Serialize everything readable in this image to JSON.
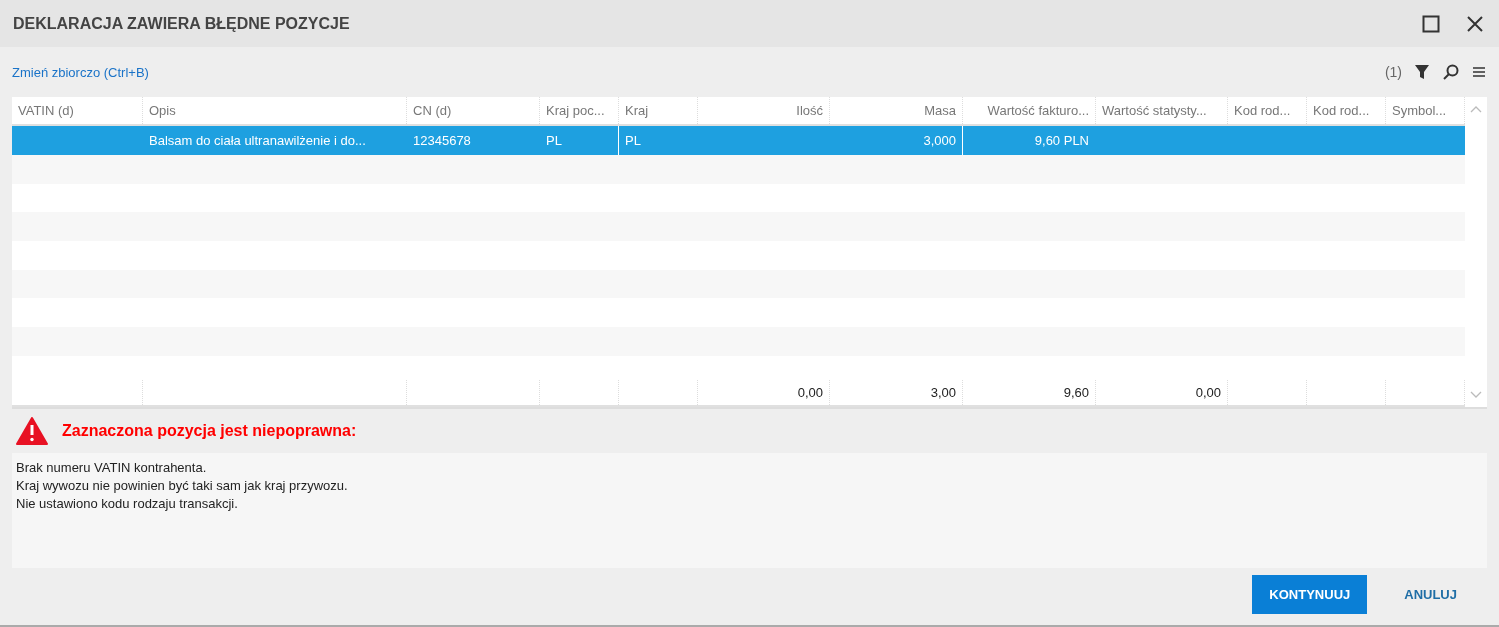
{
  "window": {
    "title": "DEKLARACJA ZAWIERA BŁĘDNE POZYCJE"
  },
  "toolbar": {
    "bulk_change_link": "Zmień zbiorczo (Ctrl+B)",
    "filter_count": "(1)"
  },
  "table": {
    "columns": [
      {
        "label": "VATIN (d)",
        "kind": "text"
      },
      {
        "label": "Opis",
        "kind": "text"
      },
      {
        "label": "CN (d)",
        "kind": "text"
      },
      {
        "label": "Kraj poc...",
        "kind": "text"
      },
      {
        "label": "Kraj",
        "kind": "text"
      },
      {
        "label": "Ilość",
        "kind": "number",
        "total": "0,00"
      },
      {
        "label": "Masa",
        "kind": "number",
        "total": "3,00"
      },
      {
        "label": "Wartość fakturo...",
        "kind": "number",
        "total": "9,60"
      },
      {
        "label": "Wartość statysty...",
        "kind": "number",
        "total": "0,00"
      },
      {
        "label": "Kod rod...",
        "kind": "text"
      },
      {
        "label": "Kod rod...",
        "kind": "text"
      },
      {
        "label": "Symbol...",
        "kind": "text"
      }
    ],
    "rows": [
      {
        "selected": true,
        "cells": [
          null,
          "Balsam do ciała ultranawilżenie i do...",
          "12345678",
          "PL",
          "PL",
          null,
          "3,000",
          "9,60 PLN",
          null,
          null,
          null,
          null
        ]
      }
    ]
  },
  "error": {
    "heading": "Zaznaczona pozycja jest niepoprawna:",
    "messages": [
      "Brak numeru VATIN kontrahenta.",
      "Kraj wywozu nie powinien być taki sam jak kraj przywozu.",
      "Nie ustawiono kodu rodzaju transakcji."
    ]
  },
  "buttons": [
    {
      "label": "KONTYNUUJ",
      "kind": "primary"
    },
    {
      "label": "ANULUJ",
      "kind": "flat"
    }
  ]
}
